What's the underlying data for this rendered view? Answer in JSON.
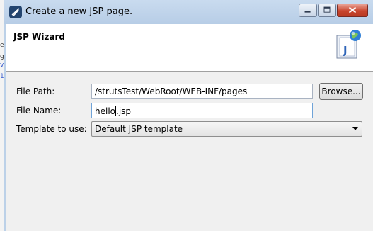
{
  "window": {
    "title": "Create a new JSP page."
  },
  "wizard": {
    "banner_title": "JSP Wizard"
  },
  "form": {
    "file_path_label": "File Path:",
    "file_path_value": "/strutsTest/WebRoot/WEB-INF/pages",
    "browse_label": "Browse...",
    "file_name_label": "File Name:",
    "file_name_before_caret": "hello",
    "file_name_after_caret": ".jsp",
    "template_label": "Template to use:",
    "template_value": "Default JSP template"
  },
  "icons": {
    "app": "eclipse-icon",
    "wizard": "jsp-globe-icon",
    "minimize": "minimize-icon",
    "maximize": "maximize-icon",
    "close": "close-icon",
    "dropdown": "chevron-down-icon"
  },
  "colors": {
    "titlebar": "#bcd1e8",
    "close_button": "#c9452d",
    "client_bg": "#f0f0f0",
    "focus_border": "#6fa3d8"
  }
}
